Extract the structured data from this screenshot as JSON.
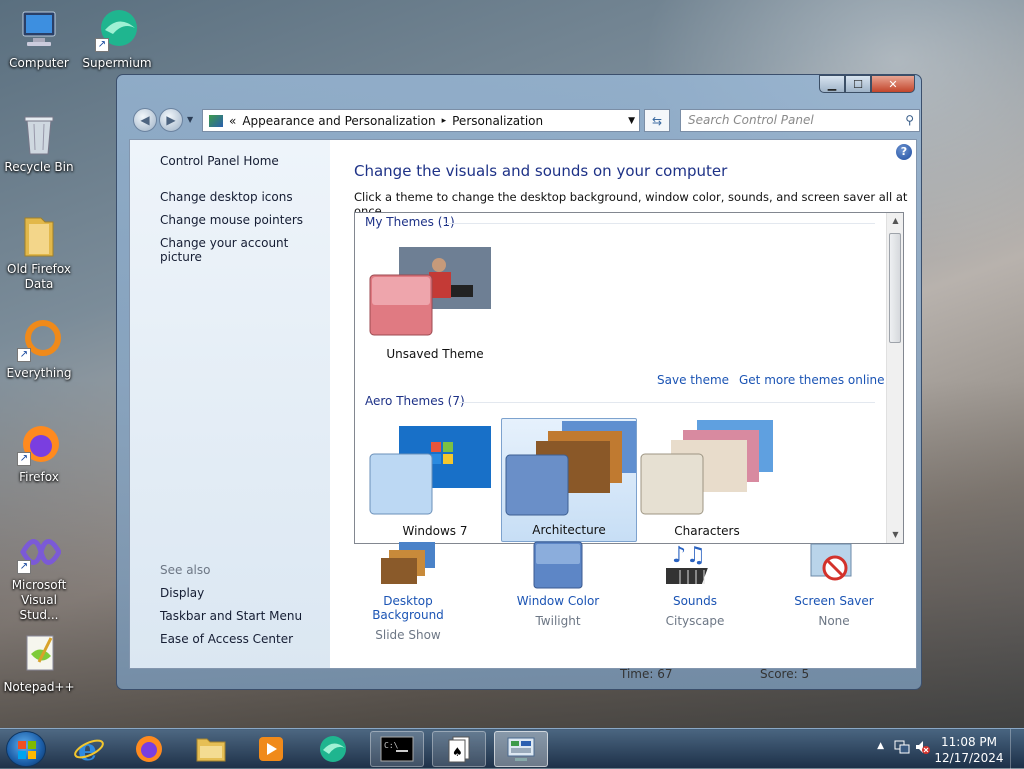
{
  "desktop": {
    "icons": [
      {
        "label": "Computer"
      },
      {
        "label": "Supermium"
      },
      {
        "label": "Recycle Bin"
      },
      {
        "label": "Old Firefox Data"
      },
      {
        "label": "Everything"
      },
      {
        "label": "Firefox"
      },
      {
        "label": "Microsoft Visual Stud..."
      },
      {
        "label": "Notepad++"
      }
    ]
  },
  "window": {
    "breadcrumb": {
      "prefix": "«",
      "part1": "Appearance and Personalization",
      "sep": "▸",
      "part2": "Personalization"
    },
    "search_placeholder": "Search Control Panel",
    "left_pane": {
      "home": "Control Panel Home",
      "links": [
        "Change desktop icons",
        "Change mouse pointers",
        "Change your account picture"
      ],
      "see_also_label": "See also",
      "see_also": [
        "Display",
        "Taskbar and Start Menu",
        "Ease of Access Center"
      ]
    },
    "main": {
      "title": "Change the visuals and sounds on your computer",
      "subtitle": "Click a theme to change the desktop background, window color, sounds, and screen saver all at once.",
      "my_themes_header": "My Themes (1)",
      "my_themes": [
        {
          "label": "Unsaved Theme"
        }
      ],
      "save_theme": "Save theme",
      "get_more": "Get more themes online",
      "aero_header": "Aero Themes (7)",
      "aero_themes": [
        {
          "label": "Windows 7"
        },
        {
          "label": "Architecture",
          "selected": true
        },
        {
          "label": "Characters"
        }
      ]
    },
    "bottom": [
      {
        "label": "Desktop Background",
        "sub": "Slide Show"
      },
      {
        "label": "Window Color",
        "sub": "Twilight"
      },
      {
        "label": "Sounds",
        "sub": "Cityscape"
      },
      {
        "label": "Screen Saver",
        "sub": "None"
      }
    ],
    "behind_text": {
      "time": "Time:  67",
      "score": "Score: 5"
    }
  },
  "taskbar": {
    "time": "11:08 PM",
    "date": "12/17/2024"
  },
  "colors": {
    "link": "#1b54b4",
    "heading": "#1e3287"
  }
}
